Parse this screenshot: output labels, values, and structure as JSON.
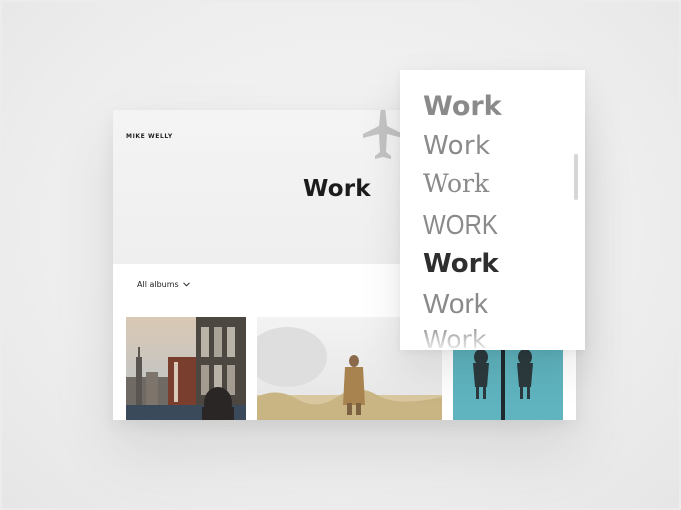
{
  "site": {
    "brand": "MIKE WELLY"
  },
  "hero": {
    "title": "Work"
  },
  "filter": {
    "label": "All albums",
    "icon": "chevron-down-icon"
  },
  "gallery": {
    "photos": [
      {
        "name": "city-building-photo"
      },
      {
        "name": "field-person-photo"
      },
      {
        "name": "teal-figures-photo"
      }
    ]
  },
  "font_picker": {
    "options": [
      {
        "label": "Work"
      },
      {
        "label": "Work"
      },
      {
        "label": "Work"
      },
      {
        "label": "WORK"
      },
      {
        "label": "Work",
        "selected": true
      },
      {
        "label": "Work"
      },
      {
        "label": "Work"
      }
    ]
  },
  "colors": {
    "background": "#ececec",
    "card": "#ffffff",
    "text_dark": "#1c1c1c",
    "text_muted": "#8a8a8a",
    "teal": "#5fb4bf"
  }
}
